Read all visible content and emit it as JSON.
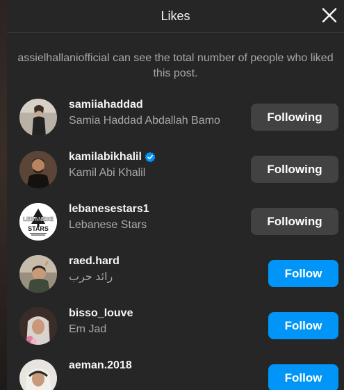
{
  "dialog": {
    "title": "Likes",
    "notice": "assielhallaniofficial can see the total number of people who liked this post."
  },
  "users": [
    {
      "username": "samiiahaddad",
      "fullname": "Samia Haddad Abdallah Bamo",
      "button": "Following",
      "verified": false
    },
    {
      "username": "kamilabikhalil",
      "fullname": "Kamil Abi Khalil",
      "button": "Following",
      "verified": true
    },
    {
      "username": "lebanesestars1",
      "fullname": "Lebanese Stars",
      "button": "Following",
      "verified": false
    },
    {
      "username": "raed.hard",
      "fullname": "رائد حرب",
      "button": "Follow",
      "verified": false
    },
    {
      "username": "bisso_louve",
      "fullname": "Em Jad",
      "button": "Follow",
      "verified": false
    },
    {
      "username": "aeman.2018",
      "fullname": "",
      "button": "Follow",
      "verified": false
    }
  ],
  "avatar_logo_text": "LEBANESE STARS",
  "colors": {
    "background": "#262626",
    "follow_blue": "#0095f6",
    "following_gray": "#424242",
    "secondary_text": "#a8a8a8",
    "verified_blue": "#0095f6"
  },
  "icons": {
    "close": "close-icon",
    "verified": "verified-badge-icon"
  }
}
